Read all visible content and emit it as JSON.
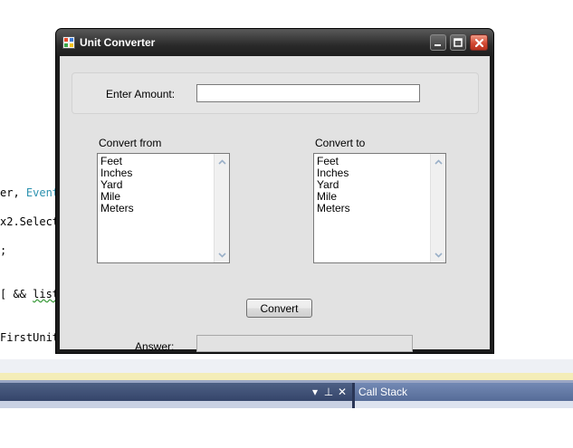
{
  "editor": {
    "lines": [
      {
        "pre": "er, ",
        "kw": "EventA",
        "post": ""
      },
      {
        "pre": "x2.Select",
        "kw": "",
        "post": ""
      },
      {
        "pre": ";",
        "kw": "",
        "post": ""
      },
      {
        "pre": "[ && ",
        "kw": "",
        "post": "listE",
        "squiggle": true
      },
      {
        "pre": "FirstUnit",
        "kw": "",
        "post": ""
      }
    ]
  },
  "ide": {
    "call_stack_title": "Call Stack",
    "ctrl_dropdown": "▾",
    "ctrl_pin": "⊥",
    "ctrl_close": "✕",
    "colors": {
      "panel_dark": "#35456a",
      "panel_light": "#566c98"
    }
  },
  "window": {
    "title": "Unit Converter",
    "enter_amount_label": "Enter Amount:",
    "amount_value": "",
    "convert_from_label": "Convert from",
    "convert_to_label": "Convert to",
    "from_units": [
      "Feet",
      "Inches",
      "Yard",
      "Mile",
      "Meters"
    ],
    "to_units": [
      "Feet",
      "Inches",
      "Yard",
      "Mile",
      "Meters"
    ],
    "convert_button": "Convert",
    "answer_label": "Answer:",
    "answer_value": "",
    "icons": {
      "app": "app-icon",
      "minimize": "minimize-icon",
      "maximize": "maximize-icon",
      "close": "close-icon"
    },
    "colors": {
      "client_bg": "#e2e2e2",
      "close_button": "#d34a33"
    }
  }
}
